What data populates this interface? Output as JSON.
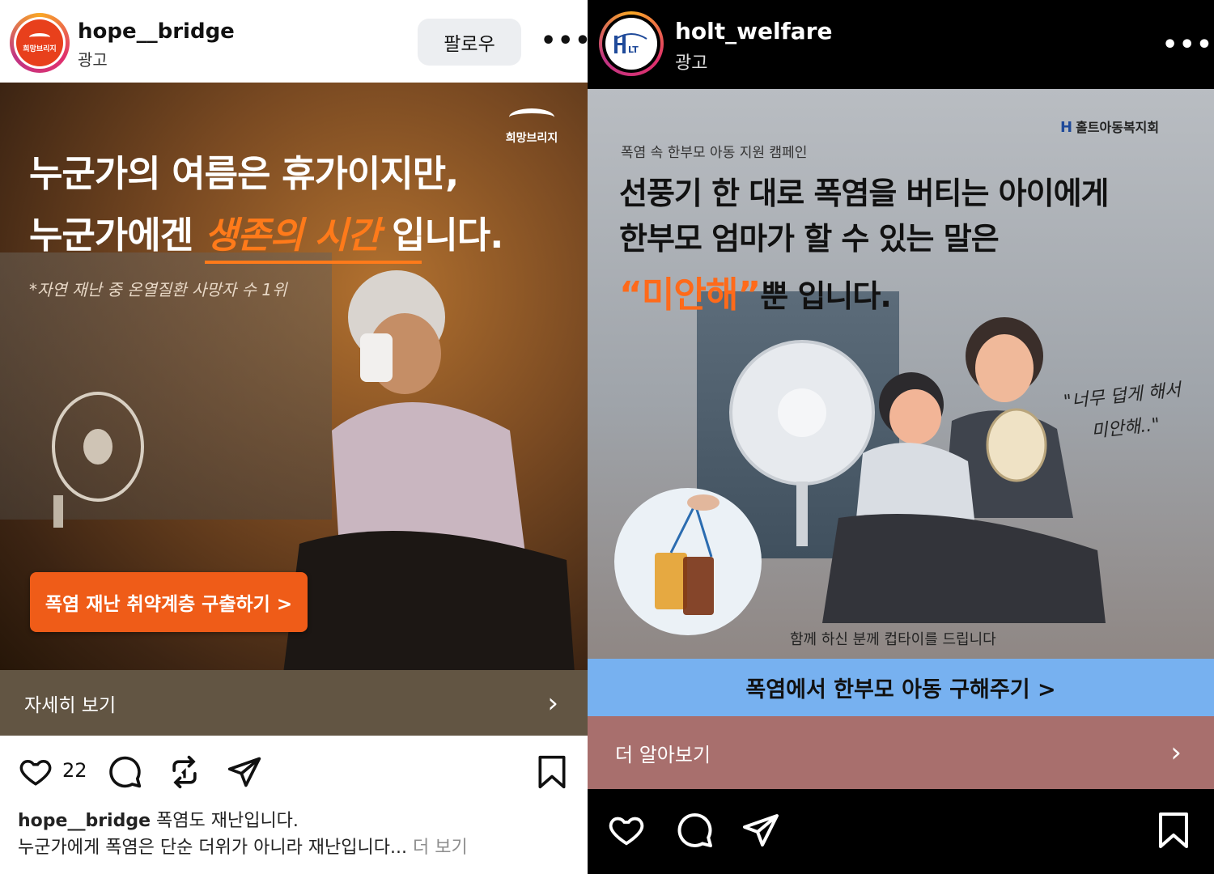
{
  "left_post": {
    "account": "hope__bridge",
    "sponsored": "광고",
    "avatar_text": "희망브리지",
    "follow_label": "팔로우",
    "more_label": "•••",
    "image": {
      "logo_text": "희망브리지",
      "line1": "누군가의 여름은 휴가이지만,",
      "line2_pre": "누군가에겐 ",
      "line2_em": "생존의 시간",
      "line2_post": " 입니다.",
      "note": "*자연 재난 중 온열질환 사망자 수 1위",
      "cta": "폭염 재난 취약계층 구출하기 >"
    },
    "detail_label": "자세히 보기",
    "chevron": "›",
    "likes_count": "22",
    "caption_account": "hope__bridge",
    "caption_text1": " 폭염도 재난입니다.",
    "caption_text2": "누군가에게 폭염은 단순 더위가 아니라 재난입니다...",
    "caption_more": " 더 보기",
    "icons": [
      "heart-icon",
      "comment-icon",
      "repost-icon",
      "send-icon",
      "bookmark-icon"
    ]
  },
  "right_post": {
    "account": "holt_welfare",
    "sponsored": "광고",
    "more_label": "•••",
    "image": {
      "logo_text": "홀트아동복지회",
      "subtitle": "폭염 속 한부모 아동 지원 캠페인",
      "line1": "선풍기 한 대로 폭염을 버티는 아이에게",
      "line2": "한부모 엄마가 할 수 있는 말은",
      "line3_em": "“미안해”",
      "line3_post": "뿐 입니다.",
      "quote1": "\"너무 덥게 해서",
      "quote2": "미안해..\"",
      "gift_text": "함께 하신 분께 컵타이를 드립니다"
    },
    "cta": "폭염에서 한부모 아동 구해주기 >",
    "detail_label": "더 알아보기",
    "chevron": "›",
    "icons": [
      "heart-icon",
      "comment-icon",
      "send-icon",
      "bookmark-icon"
    ]
  },
  "colors": {
    "orange_accent": "#ef5c18",
    "brown_bar": "#625543",
    "blue_cta": "#77b1f0",
    "rose_bar": "#a86f6d"
  }
}
